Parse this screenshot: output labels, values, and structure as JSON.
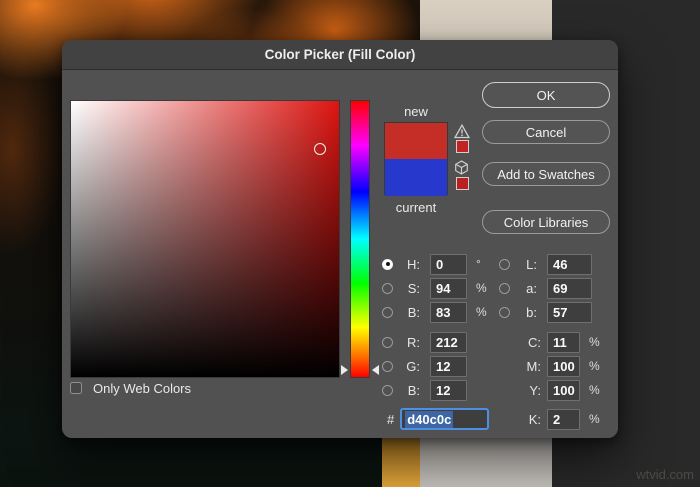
{
  "window": {
    "title": "Color Picker (Fill Color)"
  },
  "buttons": {
    "ok": "OK",
    "cancel": "Cancel",
    "add_to_swatches": "Add to Swatches",
    "color_libraries": "Color Libraries"
  },
  "swatches": {
    "new_label": "new",
    "current_label": "current",
    "new_color": "#c52e26",
    "current_color": "#2639cc",
    "gamut_warning_swatch_color": "#c32323",
    "web_safe_swatch_color": "#b92020"
  },
  "fields": {
    "h": {
      "label": "H:",
      "value": "0",
      "unit": "°",
      "selected": true
    },
    "s": {
      "label": "S:",
      "value": "94",
      "unit": "%"
    },
    "b": {
      "label": "B:",
      "value": "83",
      "unit": "%"
    },
    "r": {
      "label": "R:",
      "value": "212"
    },
    "g": {
      "label": "G:",
      "value": "12"
    },
    "b2": {
      "label": "B:",
      "value": "12"
    },
    "l": {
      "label": "L:",
      "value": "46"
    },
    "a": {
      "label": "a:",
      "value": "69"
    },
    "bb": {
      "label": "b:",
      "value": "57"
    },
    "c": {
      "label": "C:",
      "value": "11",
      "unit": "%"
    },
    "m": {
      "label": "M:",
      "value": "100",
      "unit": "%"
    },
    "y": {
      "label": "Y:",
      "value": "100",
      "unit": "%"
    },
    "k": {
      "label": "K:",
      "value": "2",
      "unit": "%"
    },
    "hex": {
      "prefix": "#",
      "value": "d40c0c"
    }
  },
  "checkbox": {
    "label": "Only Web Colors",
    "checked": false
  },
  "watermark": "wtvid.com",
  "colors": {
    "dialog_bg": "#515151",
    "titlebar_bg": "#424242",
    "focus_ring": "#4f8fe0",
    "text_selection": "#3e66a4"
  }
}
